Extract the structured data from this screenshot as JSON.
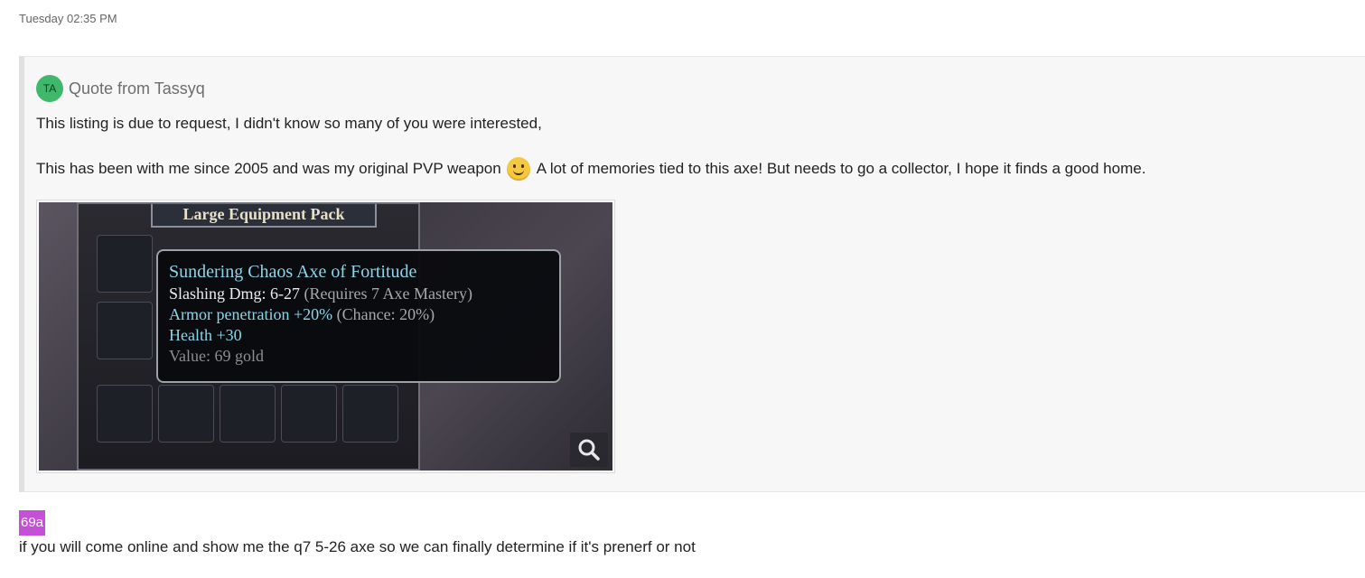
{
  "timestamp": "Tuesday 02:35 PM",
  "quote": {
    "avatar_initials": "TA",
    "from_label": "Quote from Tassyq",
    "paragraph1": "This listing is due to request, I didn't know so many of you were interested,",
    "paragraph2_before": "This has been with me since 2005 and was my original PVP weapon",
    "emoji": "smiling-face-icon",
    "paragraph2_after": "A lot of memories tied to this axe! But needs to go a collector, I hope it finds a good home.",
    "attachment": {
      "panel_title": "Large Equipment Pack",
      "tooltip": {
        "item_name": "Sundering Chaos Axe of Fortitude",
        "line1_main": "Slashing Dmg: 6-27",
        "line1_note": "(Requires 7 Axe Mastery)",
        "line2_main": "Armor penetration +20%",
        "line2_note": "(Chance: 20%)",
        "line3": "Health +30",
        "line4": "Value: 69 gold"
      },
      "zoom_icon": "magnifier-icon"
    }
  },
  "reply": {
    "user_badge": "69a",
    "text": "if you will come online and show me the q7 5-26 axe so we can finally determine if it's prenerf or not"
  },
  "colors": {
    "avatar_bg": "#3fb86b",
    "badge_bg": "#c64fd8",
    "tooltip_title": "#8ad6e8"
  }
}
